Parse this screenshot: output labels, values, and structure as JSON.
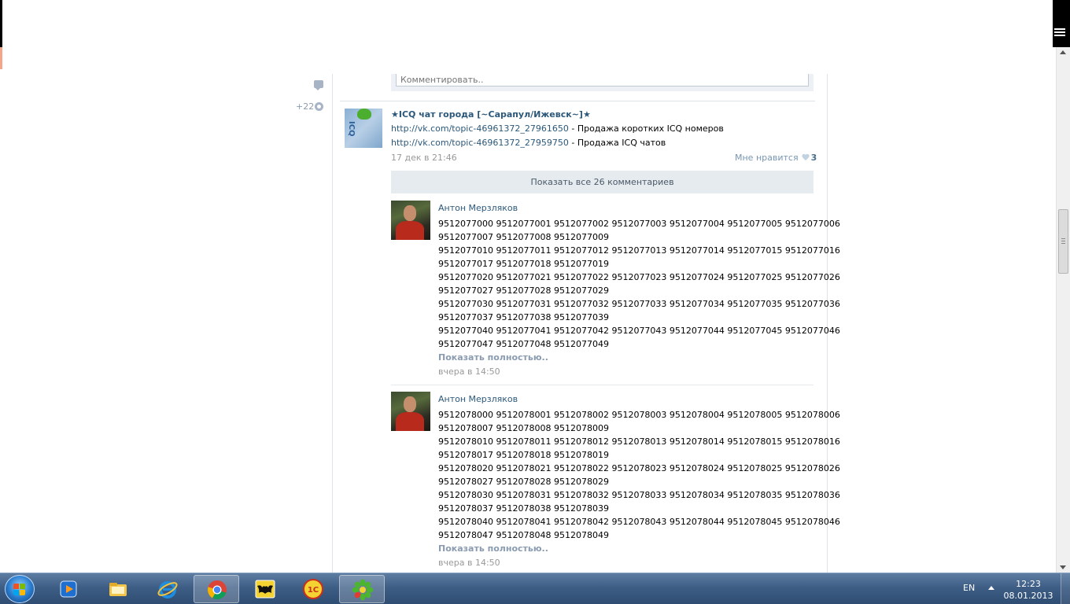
{
  "comment_box": {
    "placeholder": "Комментировать.."
  },
  "sidebar": {
    "score": "+22"
  },
  "post": {
    "title": "★ICQ чат города [~Сарапул/Ижевск~]★",
    "line1_link": "http://vk.com/topic-46961372_27961650",
    "line1_text": " - Продажа коротких ICQ номеров",
    "line2_link": "http://vk.com/topic-46961372_27959750",
    "line2_text": " - Продажа ICQ чатов",
    "date": "17 дек в 21:46",
    "like_label": "Мне нравится",
    "like_count": "3",
    "show_all": "Показать все 26 комментариев"
  },
  "comments": [
    {
      "author": "Антон Мерзляков",
      "lines": [
        "9512077000 9512077001 9512077002 9512077003 9512077004 9512077005 9512077006",
        "9512077007 9512077008 9512077009",
        "9512077010 9512077011 9512077012 9512077013 9512077014 9512077015 9512077016",
        "9512077017 9512077018 9512077019",
        "9512077020 9512077021 9512077022 9512077023 9512077024 9512077025 9512077026",
        "9512077027 9512077028 9512077029",
        "9512077030 9512077031 9512077032 9512077033 9512077034 9512077035 9512077036",
        "9512077037 9512077038 9512077039",
        "9512077040 9512077041 9512077042 9512077043 9512077044 9512077045 9512077046",
        "9512077047 9512077048 9512077049"
      ],
      "more": "Показать полностью..",
      "date": "вчера в 14:50"
    },
    {
      "author": "Антон Мерзляков",
      "lines": [
        "9512078000 9512078001 9512078002 9512078003 9512078004 9512078005 9512078006",
        "9512078007 9512078008 9512078009",
        "9512078010 9512078011 9512078012 9512078013 9512078014 9512078015 9512078016",
        "9512078017 9512078018 9512078019",
        "9512078020 9512078021 9512078022 9512078023 9512078024 9512078025 9512078026",
        "9512078027 9512078028 9512078029",
        "9512078030 9512078031 9512078032 9512078033 9512078034 9512078035 9512078036",
        "9512078037 9512078038 9512078039",
        "9512078040 9512078041 9512078042 9512078043 9512078044 9512078045 9512078046",
        "9512078047 9512078048 9512078049"
      ],
      "more": "Показать полностью..",
      "date": "вчера в 14:50"
    }
  ],
  "taskbar": {
    "apps": [
      "windows-media-player-icon",
      "file-explorer-icon",
      "internet-explorer-icon",
      "chrome-icon",
      "the-bat-icon",
      "1c-icon",
      "icq-icon"
    ],
    "onec_label": "1С",
    "lang": "EN",
    "time": "12:23",
    "date": "08.01.2013"
  },
  "colors": {
    "link": "#2b587a",
    "muted": "#999999",
    "taskbar": "#3e5e86"
  }
}
